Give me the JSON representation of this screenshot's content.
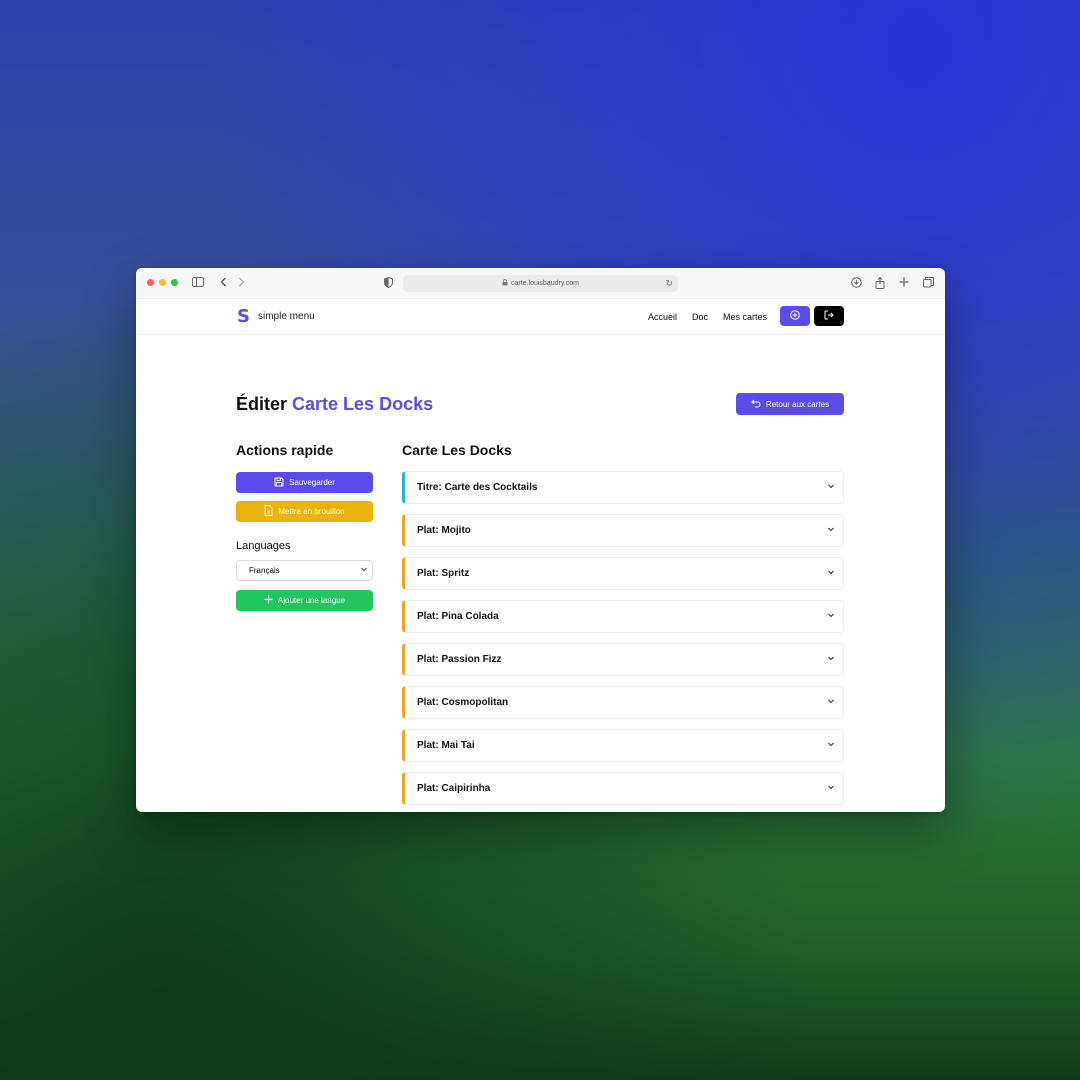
{
  "browser": {
    "url": "carte.louisbaudry.com"
  },
  "header": {
    "brand": "simple menu",
    "nav": [
      "Accueil",
      "Doc",
      "Mes cartes"
    ],
    "add_icon": "plus-circle-icon",
    "logout_icon": "logout-icon"
  },
  "page": {
    "title_prefix": "Éditer",
    "title_accent": "Carte Les Docks",
    "back_button": "Retour aux cartes"
  },
  "sidebar": {
    "title": "Actions rapide",
    "save_button": "Sauvegarder",
    "draft_button": "Mettre en brouillon",
    "languages_label": "Languages",
    "language_selected": "Français",
    "add_language_button": "Ajouter une langue"
  },
  "menu": {
    "title": "Carte Les Docks",
    "items": [
      {
        "label": "Titre: Carte des Cocktails",
        "kind": "title"
      },
      {
        "label": "Plat: Mojito",
        "kind": "plat"
      },
      {
        "label": "Plat: Spritz",
        "kind": "plat"
      },
      {
        "label": "Plat: Pina Colada",
        "kind": "plat"
      },
      {
        "label": "Plat: Passion Fizz",
        "kind": "plat"
      },
      {
        "label": "Plat: Cosmopolitan",
        "kind": "plat"
      },
      {
        "label": "Plat: Mai Tai",
        "kind": "plat"
      },
      {
        "label": "Plat: Caipirinha",
        "kind": "plat"
      }
    ]
  },
  "colors": {
    "primary": "#5b4be8",
    "draft": "#eab308",
    "success": "#22c55e",
    "title_accent_bar": "#22b8cf",
    "plat_accent_bar": "#f2a21c"
  }
}
